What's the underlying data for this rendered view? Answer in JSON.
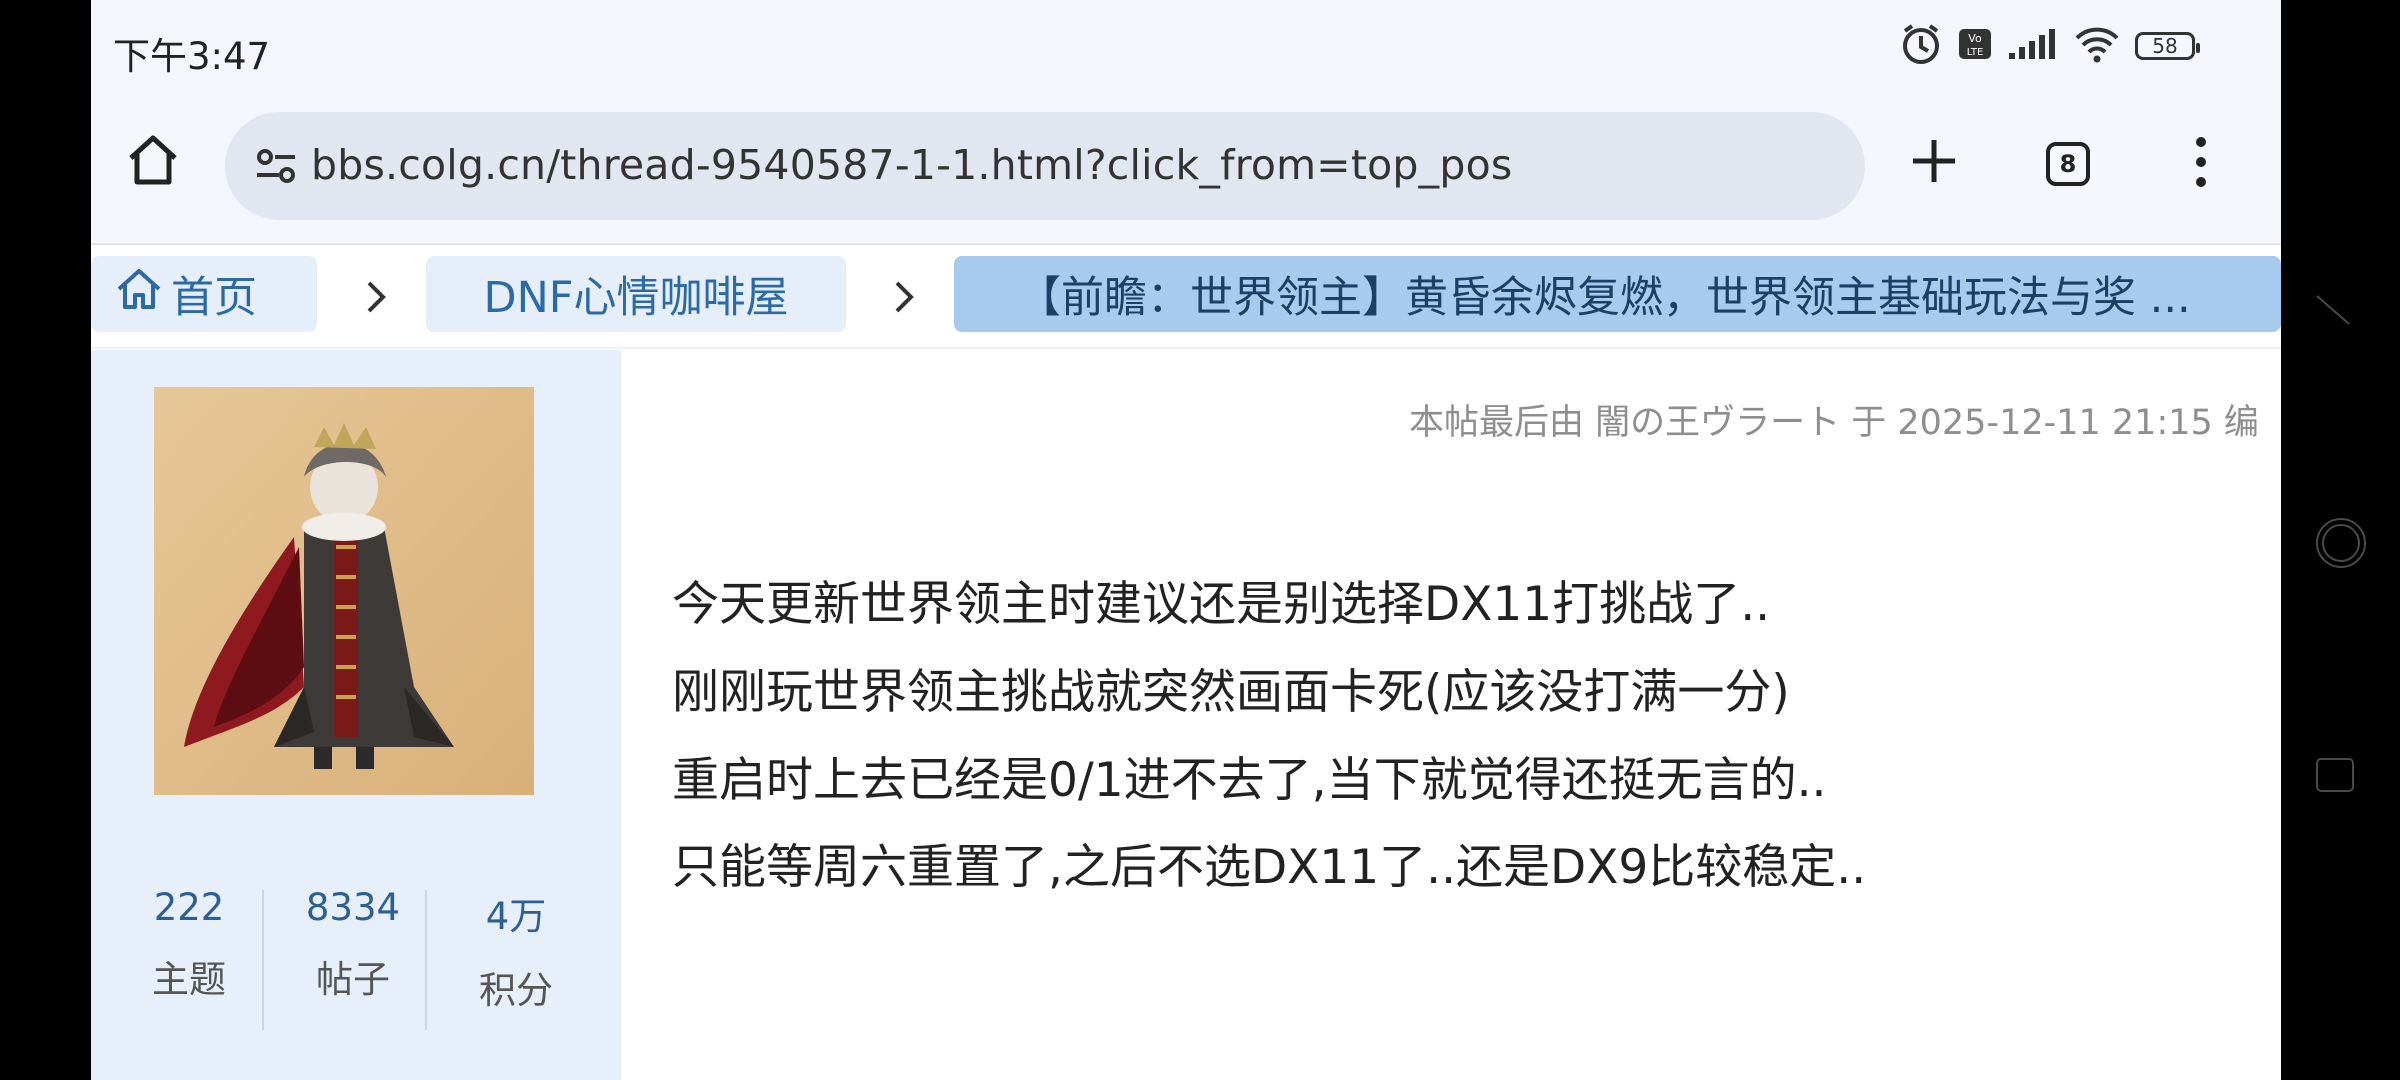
{
  "status_bar": {
    "time": "下午3:47",
    "battery": "58",
    "icons": [
      "alarm-icon",
      "volte-icon",
      "signal-icon",
      "wifi-icon",
      "battery-icon"
    ]
  },
  "browser": {
    "url": "bbs.colg.cn/thread-9540587-1-1.html?click_from=top_pos",
    "tab_count": "8",
    "icons": [
      "home-icon",
      "site-settings-icon",
      "plus-icon",
      "more-vert-icon"
    ]
  },
  "breadcrumb": {
    "home": "首页",
    "forum": "DNF心情咖啡屋",
    "thread": "【前瞻：世界领主】黄昏余烬复燃，世界领主基础玩法与奖 ..."
  },
  "sidebar": {
    "stats": [
      {
        "value": "222",
        "label": "主题"
      },
      {
        "value": "8334",
        "label": "帖子"
      },
      {
        "value": "4万",
        "label": "积分"
      }
    ],
    "more": "..."
  },
  "post": {
    "edit_note": "本帖最后由 闇の王ヴラート 于 2025-12-11 21:15 编",
    "lines": [
      "今天更新世界领主时建议还是别选择DX11打挑战了..",
      "刚刚玩世界领主挑战就突然画面卡死(应该没打满一分)",
      "重启时上去已经是0/1进不去了,当下就觉得还挺无言的..",
      "只能等周六重置了,之后不选DX11了..还是DX9比较稳定.."
    ]
  },
  "colors": {
    "accent": "#2c6aa6",
    "crumb_bg": "#e6eff9",
    "crumb_active_bg": "#a7cbee",
    "sidebar_bg": "#e7f0fa",
    "toolbar_bg": "#f4f6fb"
  }
}
